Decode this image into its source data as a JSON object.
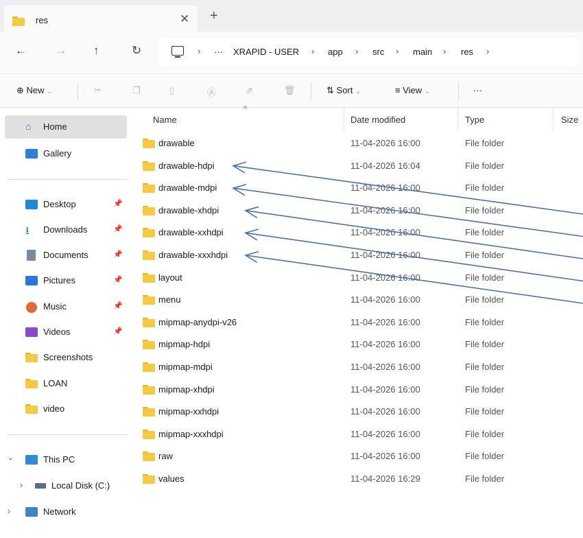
{
  "tab": {
    "title": "res"
  },
  "breadcrumb": {
    "items": [
      "XRAPID - USER",
      "app",
      "src",
      "main",
      "res"
    ]
  },
  "toolbar": {
    "new_label": "New",
    "sort_label": "Sort",
    "view_label": "View"
  },
  "sidebar": {
    "home": "Home",
    "gallery": "Gallery",
    "desktop": "Desktop",
    "downloads": "Downloads",
    "documents": "Documents",
    "pictures": "Pictures",
    "music": "Music",
    "videos": "Videos",
    "screenshots": "Screenshots",
    "loan": "LOAN",
    "video": "video",
    "this_pc": "This PC",
    "local_disk": "Local Disk (C:)",
    "network": "Network"
  },
  "columns": {
    "name": "Name",
    "date": "Date modified",
    "type": "Type",
    "size": "Size"
  },
  "files": [
    {
      "name": "drawable",
      "date": "11-04-2026 16:00",
      "type": "File folder"
    },
    {
      "name": "drawable-hdpi",
      "date": "11-04-2026 16:04",
      "type": "File folder"
    },
    {
      "name": "drawable-mdpi",
      "date": "11-04-2026 16:00",
      "type": "File folder"
    },
    {
      "name": "drawable-xhdpi",
      "date": "11-04-2026 16:00",
      "type": "File folder"
    },
    {
      "name": "drawable-xxhdpi",
      "date": "11-04-2026 16:00",
      "type": "File folder"
    },
    {
      "name": "drawable-xxxhdpi",
      "date": "11-04-2026 16:00",
      "type": "File folder"
    },
    {
      "name": "layout",
      "date": "11-04-2026 16:00",
      "type": "File folder"
    },
    {
      "name": "menu",
      "date": "11-04-2026 16:00",
      "type": "File folder"
    },
    {
      "name": "mipmap-anydpi-v26",
      "date": "11-04-2026 16:00",
      "type": "File folder"
    },
    {
      "name": "mipmap-hdpi",
      "date": "11-04-2026 16:00",
      "type": "File folder"
    },
    {
      "name": "mipmap-mdpi",
      "date": "11-04-2026 16:00",
      "type": "File folder"
    },
    {
      "name": "mipmap-xhdpi",
      "date": "11-04-2026 16:00",
      "type": "File folder"
    },
    {
      "name": "mipmap-xxhdpi",
      "date": "11-04-2026 16:00",
      "type": "File folder"
    },
    {
      "name": "mipmap-xxxhdpi",
      "date": "11-04-2026 16:00",
      "type": "File folder"
    },
    {
      "name": "raw",
      "date": "11-04-2026 16:00",
      "type": "File folder"
    },
    {
      "name": "values",
      "date": "11-04-2026 16:29",
      "type": "File folder"
    }
  ],
  "colors": {
    "folder": "#f6c945",
    "annotation_arrow": "#4a72a8",
    "selection": "#e1e1e1"
  }
}
